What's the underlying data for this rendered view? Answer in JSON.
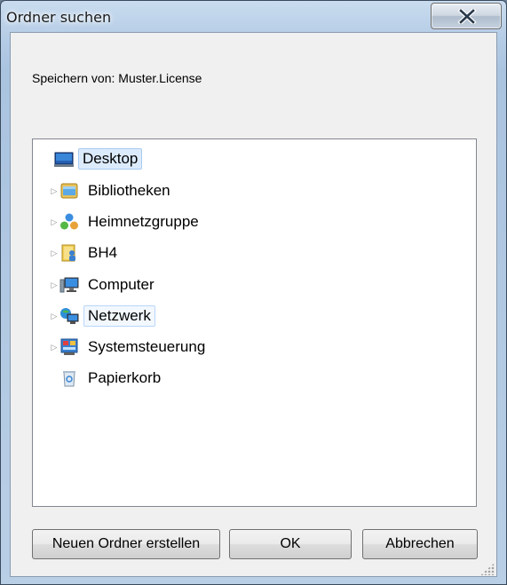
{
  "window": {
    "title": "Ordner suchen"
  },
  "dialog": {
    "save_from": "Speichern von: Muster.License"
  },
  "tree": {
    "items": [
      {
        "label": "Desktop",
        "icon": "desktop-icon",
        "has_children": false,
        "state": "selected"
      },
      {
        "label": "Bibliotheken",
        "icon": "libraries-icon",
        "has_children": true,
        "state": "normal"
      },
      {
        "label": "Heimnetzgruppe",
        "icon": "homegroup-icon",
        "has_children": true,
        "state": "normal"
      },
      {
        "label": "BH4",
        "icon": "user-folder-icon",
        "has_children": true,
        "state": "normal"
      },
      {
        "label": "Computer",
        "icon": "computer-icon",
        "has_children": true,
        "state": "normal"
      },
      {
        "label": "Netzwerk",
        "icon": "network-icon",
        "has_children": true,
        "state": "hovered"
      },
      {
        "label": "Systemsteuerung",
        "icon": "control-panel-icon",
        "has_children": true,
        "state": "normal"
      },
      {
        "label": "Papierkorb",
        "icon": "recycle-bin-icon",
        "has_children": false,
        "state": "normal"
      }
    ]
  },
  "buttons": {
    "new_folder": "Neuen Ordner erstellen",
    "ok": "OK",
    "cancel": "Abbrechen"
  },
  "colors": {
    "selection_bg": "#dcebfc",
    "selection_border": "#a8cbf1",
    "close_button": "#c6d2df"
  }
}
